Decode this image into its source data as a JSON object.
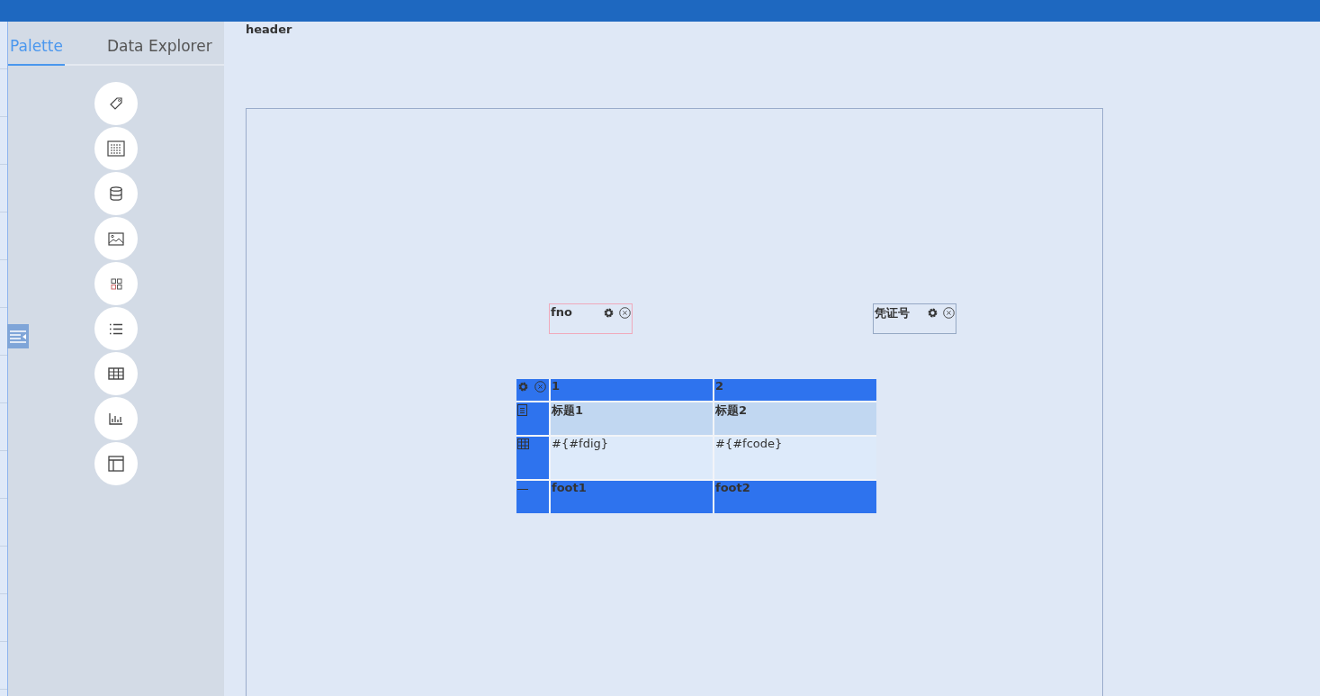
{
  "tabs": [
    {
      "label": "Palette",
      "selected": true
    },
    {
      "label": "Data Explorer",
      "selected": false
    }
  ],
  "palette": [
    {
      "kind": "tag"
    },
    {
      "kind": "table-list"
    },
    {
      "kind": "database"
    },
    {
      "kind": "image"
    },
    {
      "kind": "grid"
    },
    {
      "kind": "list"
    },
    {
      "kind": "table"
    },
    {
      "kind": "chart"
    },
    {
      "kind": "layout"
    }
  ],
  "band_title": "header",
  "fields": [
    {
      "label": "fno",
      "selected": true
    },
    {
      "label": "凭证号",
      "selected": false
    }
  ],
  "table": {
    "rows": [
      {
        "kind": "header",
        "cells": [
          "1",
          "2"
        ]
      },
      {
        "kind": "title",
        "cells": [
          "标题1",
          "标题2"
        ]
      },
      {
        "kind": "detail",
        "cells": [
          "#{#fdig}",
          "#{#fcode}"
        ]
      },
      {
        "kind": "footer",
        "cells": [
          "foot1",
          "foot2"
        ]
      }
    ]
  }
}
